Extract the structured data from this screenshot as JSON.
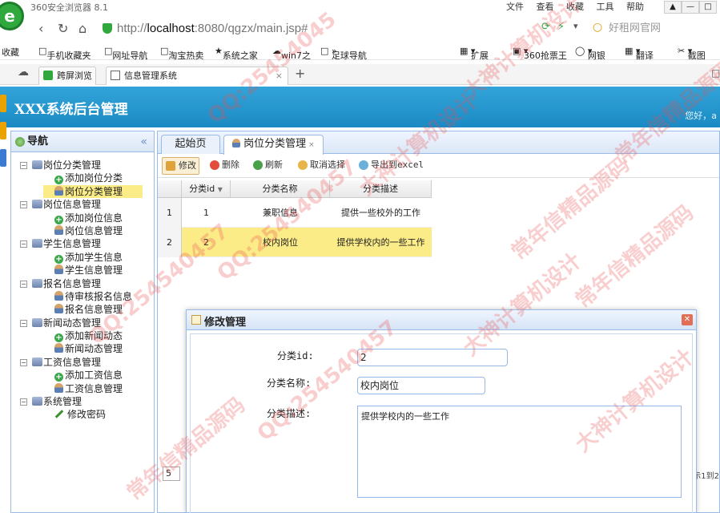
{
  "browser": {
    "title": "360安全浏览器 8.1",
    "menus": [
      "文件",
      "查看",
      "收藏",
      "工具",
      "帮助"
    ],
    "url_prefix": "http://",
    "url_host": "localhost",
    "url_rest": ":8080/qgzx/main.jsp#",
    "search_placeholder": "好租网官网",
    "bookmarks": [
      "收藏",
      "手机收藏夹",
      "网址导航",
      "淘宝热卖",
      "系统之家",
      "win7之",
      "足球导航",
      "扩展",
      "360抢票王",
      "网银",
      "翻译",
      "截图"
    ],
    "tabs": [
      "跨屏浏览",
      "信息管理系统"
    ]
  },
  "app": {
    "title": "XXX系统后台管理",
    "greeting": "您好，a"
  },
  "nav": {
    "title": "导航",
    "groups": [
      {
        "label": "岗位分类管理",
        "items": [
          {
            "label": "添加岗位分类",
            "icon": "add"
          },
          {
            "label": "岗位分类管理",
            "icon": "user",
            "selected": true
          }
        ]
      },
      {
        "label": "岗位信息管理",
        "items": [
          {
            "label": "添加岗位信息",
            "icon": "add"
          },
          {
            "label": "岗位信息管理",
            "icon": "user"
          }
        ]
      },
      {
        "label": "学生信息管理",
        "items": [
          {
            "label": "添加学生信息",
            "icon": "add"
          },
          {
            "label": "学生信息管理",
            "icon": "user"
          }
        ]
      },
      {
        "label": "报名信息管理",
        "items": [
          {
            "label": "待审核报名信息",
            "icon": "user"
          },
          {
            "label": "报名信息管理",
            "icon": "user"
          }
        ]
      },
      {
        "label": "新闻动态管理",
        "items": [
          {
            "label": "添加新闻动态",
            "icon": "add"
          },
          {
            "label": "新闻动态管理",
            "icon": "user"
          }
        ]
      },
      {
        "label": "工资信息管理",
        "items": [
          {
            "label": "添加工资信息",
            "icon": "add"
          },
          {
            "label": "工资信息管理",
            "icon": "user"
          }
        ]
      },
      {
        "label": "系统管理",
        "items": [
          {
            "label": "修改密码",
            "icon": "pen"
          }
        ]
      }
    ]
  },
  "main": {
    "tabs": [
      {
        "label": "起始页"
      },
      {
        "label": "岗位分类管理",
        "active": true
      }
    ],
    "toolbar": [
      "修改",
      "删除",
      "刷新",
      "取消选择",
      "导出到excel"
    ],
    "toolbar_colors": [
      "#e0a33a",
      "#e24c3b",
      "#4aa04a",
      "#e6b64a",
      "#6bb0d8"
    ],
    "grid": {
      "columns": [
        "分类id",
        "分类名称",
        "分类描述"
      ],
      "rows": [
        {
          "num": "1",
          "id": "1",
          "name": "兼职信息",
          "desc": "提供一些校外的工作"
        },
        {
          "num": "2",
          "id": "2",
          "name": "校内岗位",
          "desc": "提供学校内的一些工作",
          "selected": true
        }
      ]
    },
    "pager_value": "5",
    "pager_info": "示1到2"
  },
  "dialog": {
    "title": "修改管理",
    "fields": {
      "id_label": "分类id:",
      "id_value": "2",
      "name_label": "分类名称:",
      "name_value": "校内岗位",
      "desc_label": "分类描述:",
      "desc_value": "提供学校内的一些工作"
    }
  },
  "watermarks": [
    "QQ:25454045",
    "大神计算机设计",
    "常年信精品源码",
    "QQ:254540457",
    "大神计算机设计",
    "常年信精品源码",
    "QQ:254540457",
    "大神计算机设计",
    "常年信精品源码",
    "QQ:254540457",
    "大神计算机设计",
    "常年信精品源码"
  ]
}
